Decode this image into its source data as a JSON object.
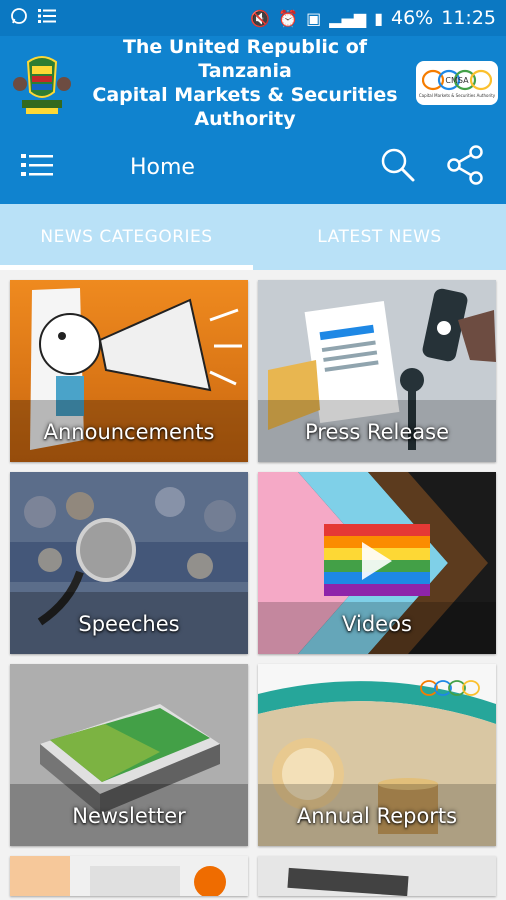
{
  "status_bar": {
    "battery": "46%",
    "time": "11:25"
  },
  "header": {
    "title_line1": "The United Republic of Tanzania",
    "title_line2": "Capital Markets & Securities",
    "title_line3": "Authority",
    "logo_text": "CMSA",
    "logo_subtitle": "Capital Markets & Securities Authority"
  },
  "toolbar": {
    "title": "Home"
  },
  "tabs": [
    {
      "label": "NEWS CATEGORIES"
    },
    {
      "label": "LATEST NEWS"
    }
  ],
  "categories": [
    {
      "label": "Announcements"
    },
    {
      "label": "Press Release"
    },
    {
      "label": "Speeches"
    },
    {
      "label": "Videos"
    },
    {
      "label": "Newsletter"
    },
    {
      "label": "Annual Reports"
    }
  ],
  "colors": {
    "primary": "#1083cf",
    "status_bar": "#0b78c2",
    "tab_bar": "#b9e1f7"
  }
}
